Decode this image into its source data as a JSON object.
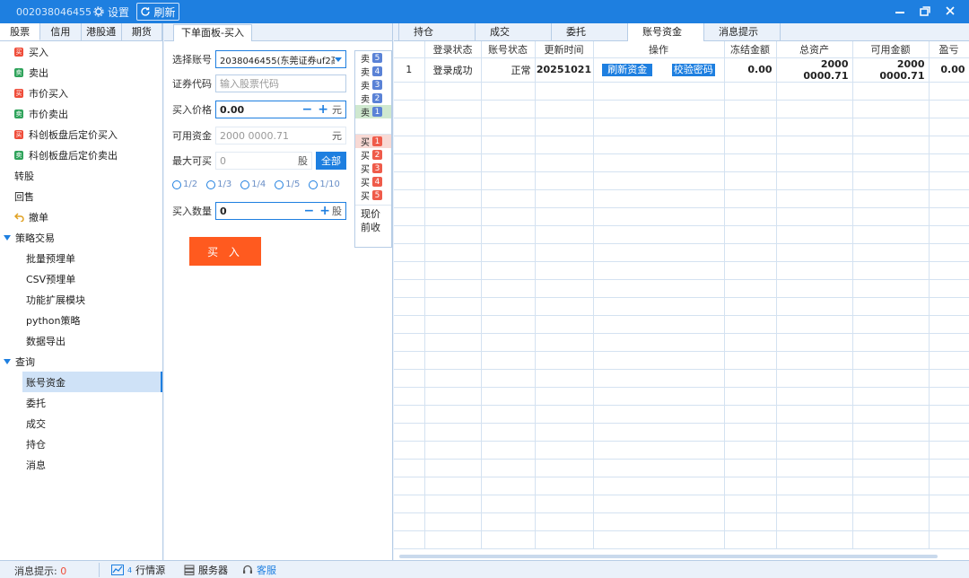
{
  "titlebar": {
    "account": "002038046455",
    "settings_label": "设置",
    "refresh_label": "刷新"
  },
  "sidebar": {
    "tabs": [
      "股票",
      "信用",
      "港股通",
      "期货"
    ],
    "trade_items": [
      {
        "label": "买入",
        "icon": "buy-icon",
        "badge": "买"
      },
      {
        "label": "卖出",
        "icon": "sell-icon",
        "badge": "卖"
      },
      {
        "label": "市价买入",
        "icon": "buy-icon",
        "badge": "买"
      },
      {
        "label": "市价卖出",
        "icon": "sell-icon",
        "badge": "卖"
      },
      {
        "label": "科创板盘后定价买入",
        "icon": "buy-icon",
        "badge": "买"
      },
      {
        "label": "科创板盘后定价卖出",
        "icon": "sell-icon",
        "badge": "卖"
      }
    ],
    "plain_items": [
      "转股",
      "回售"
    ],
    "cancel_label": "撤单",
    "strategy_group": "策略交易",
    "strategy_items": [
      "批量预埋单",
      "CSV预埋单",
      "功能扩展模块",
      "python策略",
      "数据导出"
    ],
    "query_group": "查询",
    "query_items": [
      "账号资金",
      "委托",
      "成交",
      "持仓",
      "消息"
    ]
  },
  "order": {
    "tab_label": "下单面板-买入",
    "account_label": "选择账号",
    "account_value": "2038046455(东莞证券uf2高",
    "code_label": "证券代码",
    "code_placeholder": "输入股票代码",
    "price_label": "买入价格",
    "price_value": "0.00",
    "price_unit": "元",
    "funds_label": "可用资金",
    "funds_value": "2000 0000.71",
    "funds_unit": "元",
    "max_label": "最大可买",
    "max_value": "0",
    "max_unit": "股",
    "all_label": "全部",
    "fractions": [
      "1/2",
      "1/3",
      "1/4",
      "1/5",
      "1/10"
    ],
    "qty_label": "买入数量",
    "qty_value": "0",
    "qty_unit": "股",
    "buy_button": "买 入"
  },
  "depth": {
    "sell_label": "卖",
    "buy_label": "买",
    "sell_levels": [
      "5",
      "4",
      "3",
      "2",
      "1"
    ],
    "buy_levels": [
      "1",
      "2",
      "3",
      "4",
      "5"
    ],
    "current_price_label": "现价",
    "prev_close_label": "前收"
  },
  "right": {
    "tabs": [
      "持仓",
      "成交",
      "委托",
      "账号资金",
      "消息提示"
    ],
    "active_tab": 3,
    "columns": [
      "",
      "登录状态",
      "账号状态",
      "更新时间",
      "操作",
      "冻结金额",
      "总资产",
      "可用金额",
      "盈亏"
    ],
    "rows": [
      {
        "index": "1",
        "login_status": "登录成功",
        "account_status": "正常",
        "update_time": "20251021",
        "action1": "刷新资金",
        "action2": "校验密码",
        "frozen": "0.00",
        "total": "2000 0000.71",
        "available": "2000 0000.71",
        "pnl": "0.00"
      }
    ]
  },
  "statusbar": {
    "message_label": "消息提示:",
    "message_count": "0",
    "market_label": "行情源",
    "market_sub": "4",
    "server_label": "服务器",
    "service_label": "客服"
  },
  "colors": {
    "titlebar": "#1e7fe0",
    "buy": "#ef4d3a",
    "sell": "#2fa35b",
    "buy_button": "#ff5a1f"
  }
}
